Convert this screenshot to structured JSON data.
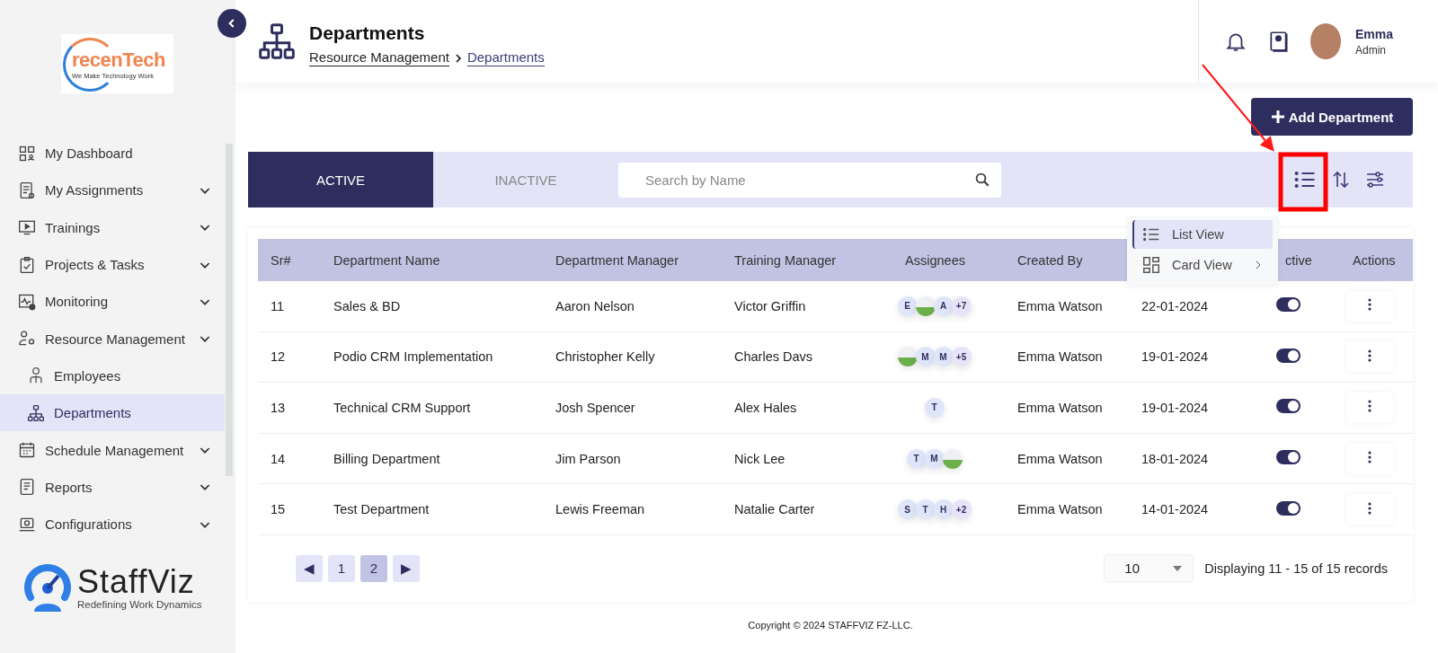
{
  "sidebar": {
    "logo": {
      "name": "recenTech",
      "tagline": "We Make Technology Work"
    },
    "items": [
      {
        "label": "My Dashboard",
        "selected": false
      },
      {
        "label": "My Assignments",
        "selected": false,
        "has_chevron": true
      },
      {
        "label": "Trainings",
        "selected": false,
        "has_chevron": true
      },
      {
        "label": "Projects & Tasks",
        "selected": false,
        "has_chevron": true
      },
      {
        "label": "Monitoring",
        "selected": false,
        "has_chevron": true
      },
      {
        "label": "Resource Management",
        "selected": false,
        "has_chevron": true,
        "children": [
          {
            "label": "Employees",
            "selected": false
          },
          {
            "label": "Departments",
            "selected": true
          }
        ]
      },
      {
        "label": "Schedule Management",
        "selected": false,
        "has_chevron": true
      },
      {
        "label": "Reports",
        "selected": false,
        "has_chevron": true
      },
      {
        "label": "Configurations",
        "selected": false,
        "has_chevron": true
      }
    ],
    "brand": {
      "name": "StaffViz",
      "tagline": "Redefining Work Dynamics"
    }
  },
  "header": {
    "title": "Departments",
    "breadcrumb": [
      "Resource Management",
      "Departments"
    ],
    "user": {
      "name": "Emma",
      "role": "Admin"
    }
  },
  "add_button": "Add Department",
  "tabs": [
    {
      "label": "ACTIVE",
      "selected": true
    },
    {
      "label": "INACTIVE",
      "selected": false
    }
  ],
  "search": {
    "placeholder": "Search by Name"
  },
  "view_menu": [
    {
      "label": "List View",
      "selected": true
    },
    {
      "label": "Card View",
      "selected": false,
      "has_submenu": true
    }
  ],
  "table": {
    "columns": [
      "Sr#",
      "Department Name",
      "Department Manager",
      "Training Manager",
      "Assignees",
      "Created By",
      null,
      "ctive",
      "Actions"
    ],
    "rows": [
      {
        "sr": "11",
        "name": "Sales & BD",
        "manager": "Aaron Nelson",
        "trainer": "Victor Griffin",
        "assignees": [
          {
            "kind": "letter",
            "text": "E"
          },
          {
            "kind": "photo"
          },
          {
            "kind": "letter",
            "text": "A"
          },
          {
            "kind": "more",
            "text": "+7"
          }
        ],
        "created_by": "Emma Watson",
        "date": "22-01-2024",
        "on": true
      },
      {
        "sr": "12",
        "name": "Podio CRM Implementation",
        "manager": "Christopher Kelly",
        "trainer": "Charles Davs",
        "assignees": [
          {
            "kind": "photo"
          },
          {
            "kind": "letter",
            "text": "M"
          },
          {
            "kind": "letter",
            "text": "M"
          },
          {
            "kind": "more",
            "text": "+5"
          }
        ],
        "created_by": "Emma Watson",
        "date": "19-01-2024",
        "on": true
      },
      {
        "sr": "13",
        "name": "Technical CRM Support",
        "manager": "Josh Spencer",
        "trainer": "Alex Hales",
        "assignees": [
          {
            "kind": "letter",
            "text": "T"
          }
        ],
        "created_by": "Emma Watson",
        "date": "19-01-2024",
        "on": true
      },
      {
        "sr": "14",
        "name": "Billing Department",
        "manager": "Jim Parson",
        "trainer": "Nick Lee",
        "assignees": [
          {
            "kind": "letter",
            "text": "T"
          },
          {
            "kind": "letter",
            "text": "M"
          },
          {
            "kind": "photo"
          }
        ],
        "created_by": "Emma Watson",
        "date": "18-01-2024",
        "on": true
      },
      {
        "sr": "15",
        "name": "Test Department",
        "manager": "Lewis Freeman",
        "trainer": "Natalie Carter",
        "assignees": [
          {
            "kind": "letter",
            "text": "S"
          },
          {
            "kind": "letter",
            "text": "T"
          },
          {
            "kind": "letter",
            "text": "H"
          },
          {
            "kind": "more",
            "text": "+2"
          }
        ],
        "created_by": "Emma Watson",
        "date": "14-01-2024",
        "on": true
      }
    ]
  },
  "pagination": {
    "prev": "◀",
    "next": "▶",
    "pages": [
      {
        "label": "1",
        "selected": false
      },
      {
        "label": "2",
        "selected": true
      }
    ],
    "page_size": "10",
    "summary": "Displaying 11 - 15 of 15 records"
  },
  "footer": "Copyright © 2024 STAFFVIZ FZ-LLC."
}
